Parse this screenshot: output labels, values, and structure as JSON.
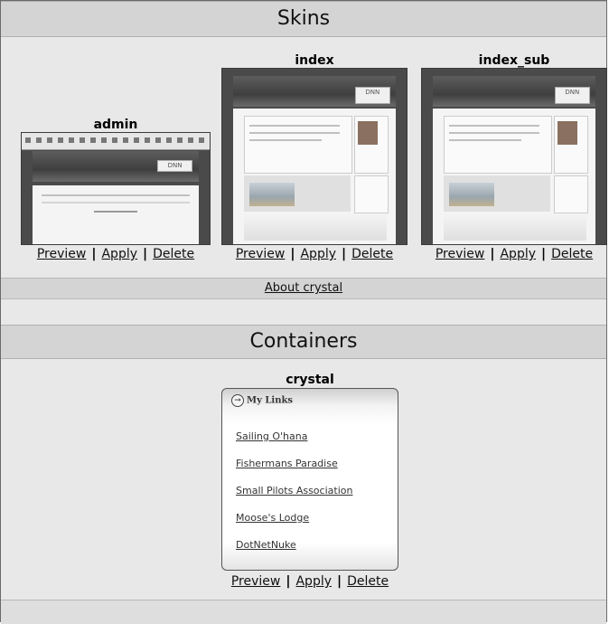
{
  "skins_header": "Skins",
  "containers_header": "Containers",
  "skins": [
    {
      "name": "admin",
      "preview": "Preview",
      "apply": "Apply",
      "delete": "Delete"
    },
    {
      "name": "index",
      "preview": "Preview",
      "apply": "Apply",
      "delete": "Delete"
    },
    {
      "name": "index_sub",
      "preview": "Preview",
      "apply": "Apply",
      "delete": "Delete"
    }
  ],
  "about_link": "About crystal",
  "container": {
    "name": "crystal",
    "preview_title": "My Links",
    "links": [
      "Sailing O'hana",
      "Fishermans Paradise",
      "Small Pilots Association",
      "Moose's Lodge",
      "DotNetNuke"
    ],
    "preview": "Preview",
    "apply": "Apply",
    "delete": "Delete"
  },
  "separator": "|",
  "colors": {
    "header_bg": "#d4d4d4",
    "panel_bg": "#e8e8e8",
    "thumb_frame": "#4a4a4a"
  }
}
